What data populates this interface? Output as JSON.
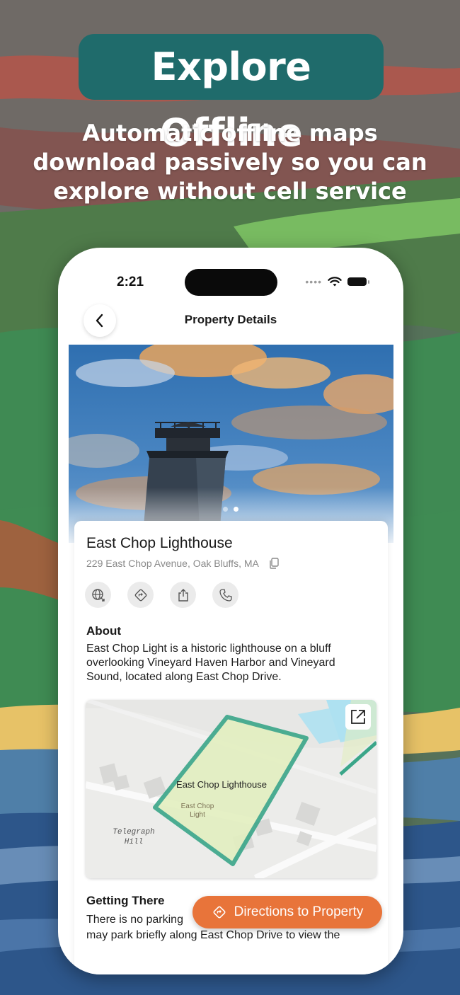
{
  "promo": {
    "title": "Explore Offline",
    "subtitle": "Automatic offline maps download passively so you can explore without cell service"
  },
  "status_bar": {
    "time": "2:21"
  },
  "header": {
    "title": "Property Details",
    "back_icon": "chevron-left-icon"
  },
  "gallery": {
    "page_count": 2,
    "active_page": 2
  },
  "place": {
    "name": "East Chop Lighthouse",
    "address": "229 East Chop Avenue, Oak Bluffs, MA",
    "copy_icon": "copy-icon"
  },
  "actions": [
    {
      "icon": "website-icon"
    },
    {
      "icon": "directions-icon"
    },
    {
      "icon": "share-icon"
    },
    {
      "icon": "phone-icon"
    }
  ],
  "about": {
    "title": "About",
    "text": "East Chop Light is a historic lighthouse on a bluff overlooking Vineyard Haven Harbor and Vineyard Sound, located along East Chop Drive."
  },
  "map": {
    "property_label": "East Chop Lighthouse",
    "poi_label_line1": "East Chop",
    "poi_label_line2": "Light",
    "place_label_line1": "Telegraph",
    "place_label_line2": "Hill",
    "expand_icon": "expand-icon"
  },
  "getting_there": {
    "title": "Getting There",
    "line1": "There is no parking",
    "line2": "may park briefly along East Chop Drive to view the"
  },
  "cta": {
    "label": "Directions to Property",
    "icon": "directions-icon"
  },
  "colors": {
    "accent": "#e8743a",
    "brand": "#1f6b6b",
    "property_outline": "#3aa689",
    "property_fill": "#e3efc0"
  }
}
